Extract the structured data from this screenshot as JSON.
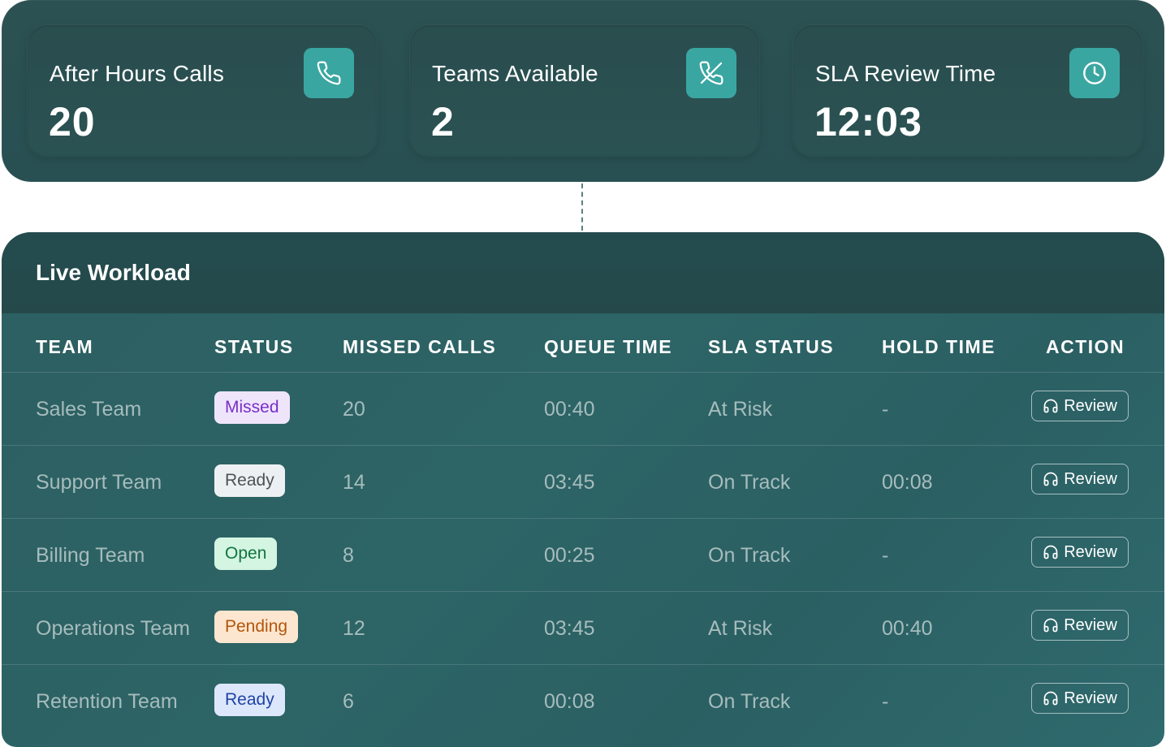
{
  "kpis": [
    {
      "label": "After Hours Calls",
      "value": "20",
      "icon": "phone-icon"
    },
    {
      "label": "Teams Available",
      "value": "2",
      "icon": "phone-slash-icon"
    },
    {
      "label": "SLA Review Time",
      "value": "12:03",
      "icon": "clock-icon"
    }
  ],
  "workload": {
    "title": "Live Workload",
    "columns": [
      "TEAM",
      "STATUS",
      "MISSED CALLS",
      "QUEUE TIME",
      "SLA STATUS",
      "HOLD TIME",
      "ACTION"
    ],
    "rows": [
      {
        "team": "Sales Team",
        "status": "Missed",
        "missed_calls": "20",
        "queue_time": "00:40",
        "sla_status": "At Risk",
        "hold_time": "-",
        "action": "Review"
      },
      {
        "team": "Support Team",
        "status": "Ready",
        "missed_calls": "14",
        "queue_time": "03:45",
        "sla_status": "On Track",
        "hold_time": "00:08",
        "action": "Review"
      },
      {
        "team": "Billing Team",
        "status": "Open",
        "missed_calls": "8",
        "queue_time": "00:25",
        "sla_status": "On Track",
        "hold_time": "-",
        "action": "Review"
      },
      {
        "team": "Operations Team",
        "status": "Pending",
        "missed_calls": "12",
        "queue_time": "03:45",
        "sla_status": "At Risk",
        "hold_time": "00:40",
        "action": "Review"
      },
      {
        "team": "Retention Team",
        "status": "Ready",
        "missed_calls": "6",
        "queue_time": "00:08",
        "sla_status": "On Track",
        "hold_time": "-",
        "action": "Review"
      }
    ]
  },
  "colors": {
    "panel": "#2c5152",
    "accent": "#3aa6a1",
    "missed_badge": "#efe5fb",
    "ready_badge_gray": "#edf0f2",
    "open_badge": "#d3f5e1",
    "pending_badge": "#fde6cf",
    "ready_badge_blue": "#dde7fb"
  }
}
